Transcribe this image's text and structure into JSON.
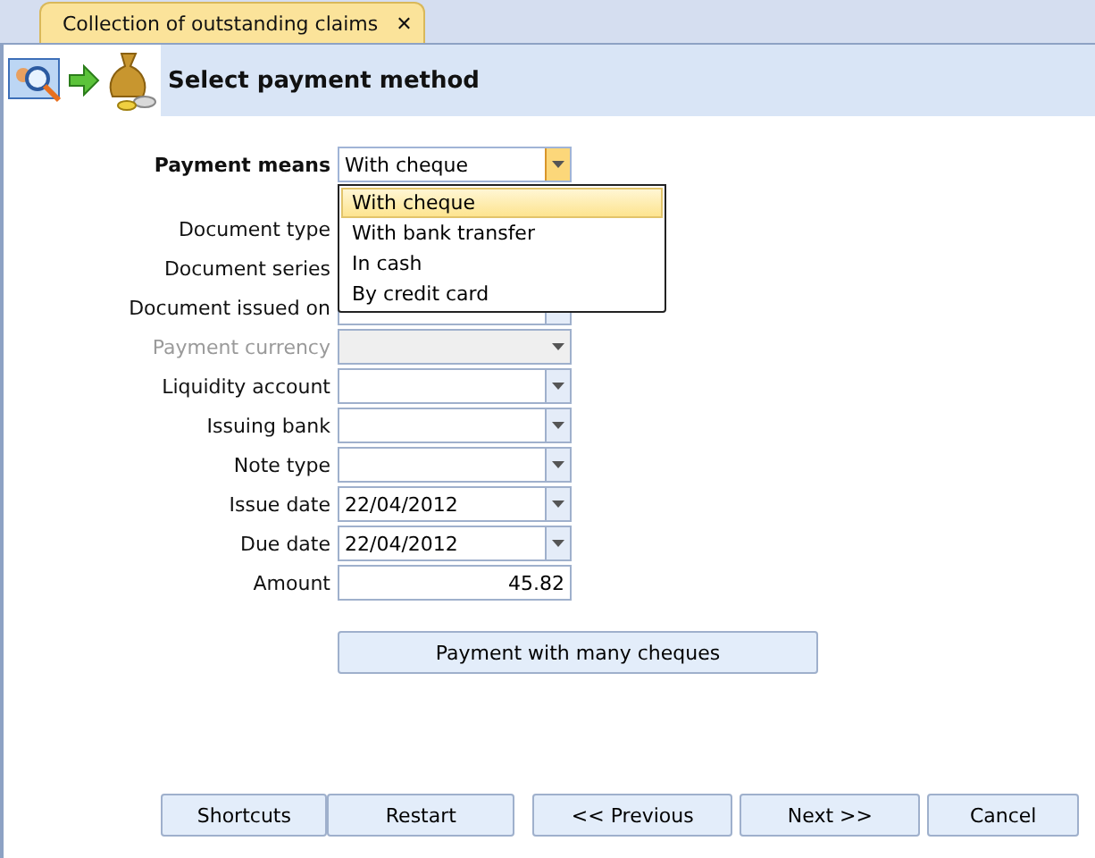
{
  "tab": {
    "title": "Collection of outstanding claims",
    "close": "✕",
    "selected": true
  },
  "header": {
    "title": "Select payment method"
  },
  "payment_means": {
    "label": "Payment means",
    "value": "With cheque",
    "expanded": true,
    "options": [
      {
        "label": "With cheque",
        "selected": true
      },
      {
        "label": "With bank transfer",
        "selected": false
      },
      {
        "label": "In cash",
        "selected": false
      },
      {
        "label": "By credit card",
        "selected": false
      }
    ]
  },
  "fields": [
    {
      "label": "Document type",
      "kind": "covered",
      "disabled": false
    },
    {
      "label": "Document series",
      "kind": "covered",
      "disabled": false
    },
    {
      "label": "Document issued on",
      "kind": "combo",
      "disabled": false
    },
    {
      "label": "Payment currency",
      "kind": "combo",
      "disabled": true
    },
    {
      "label": "Liquidity account",
      "kind": "combo",
      "disabled": false
    },
    {
      "label": "Issuing bank",
      "kind": "combo",
      "disabled": false
    },
    {
      "label": "Note type",
      "kind": "combo",
      "disabled": false
    },
    {
      "label": "Issue date",
      "kind": "combo",
      "disabled": false,
      "value": "22/04/2012"
    },
    {
      "label": "Due date",
      "kind": "combo",
      "disabled": false,
      "value": "22/04/2012"
    },
    {
      "label": "Amount",
      "kind": "number",
      "disabled": false,
      "value": "45.82"
    }
  ],
  "many_cheques_button": "Payment with many cheques",
  "buttons": [
    {
      "label": "Shortcuts",
      "kind": "left"
    },
    {
      "label": "Restart",
      "kind": "right"
    },
    {
      "label": "<< Previous",
      "kind": "right"
    },
    {
      "label": "Next >>",
      "kind": "right"
    },
    {
      "label": "Cancel",
      "kind": "right"
    }
  ]
}
